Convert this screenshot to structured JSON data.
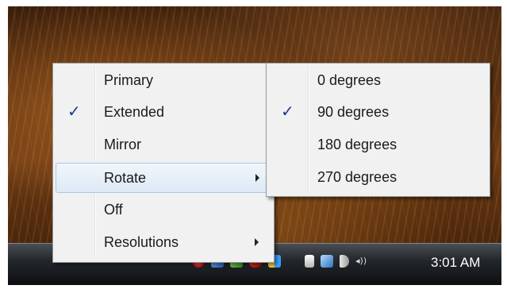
{
  "context_menu": {
    "items": [
      {
        "label": "Primary",
        "checked": false,
        "submenu": false
      },
      {
        "label": "Extended",
        "checked": true,
        "submenu": false
      },
      {
        "label": "Mirror",
        "checked": false,
        "submenu": false
      },
      {
        "label": "Rotate",
        "checked": false,
        "submenu": true,
        "highlighted": true
      },
      {
        "label": "Off",
        "checked": false,
        "submenu": false
      },
      {
        "label": "Resolutions",
        "checked": false,
        "submenu": true
      }
    ],
    "check_glyph": "✓"
  },
  "rotate_submenu": {
    "items": [
      {
        "label": "0 degrees",
        "checked": false
      },
      {
        "label": "90 degrees",
        "checked": true
      },
      {
        "label": "180 degrees",
        "checked": false
      },
      {
        "label": "270 degrees",
        "checked": false
      }
    ]
  },
  "taskbar": {
    "clock": "3:01 AM",
    "tray_icons": [
      "security-alert-icon",
      "network-app-icon",
      "green-app-icon",
      "shield-icon",
      "display-app-icon",
      "power-icon",
      "network-icon",
      "volume-icon"
    ]
  },
  "colors": {
    "menu_background": "#f1f1f1",
    "highlight": "#dde9f6",
    "check": "#1f3a93"
  }
}
